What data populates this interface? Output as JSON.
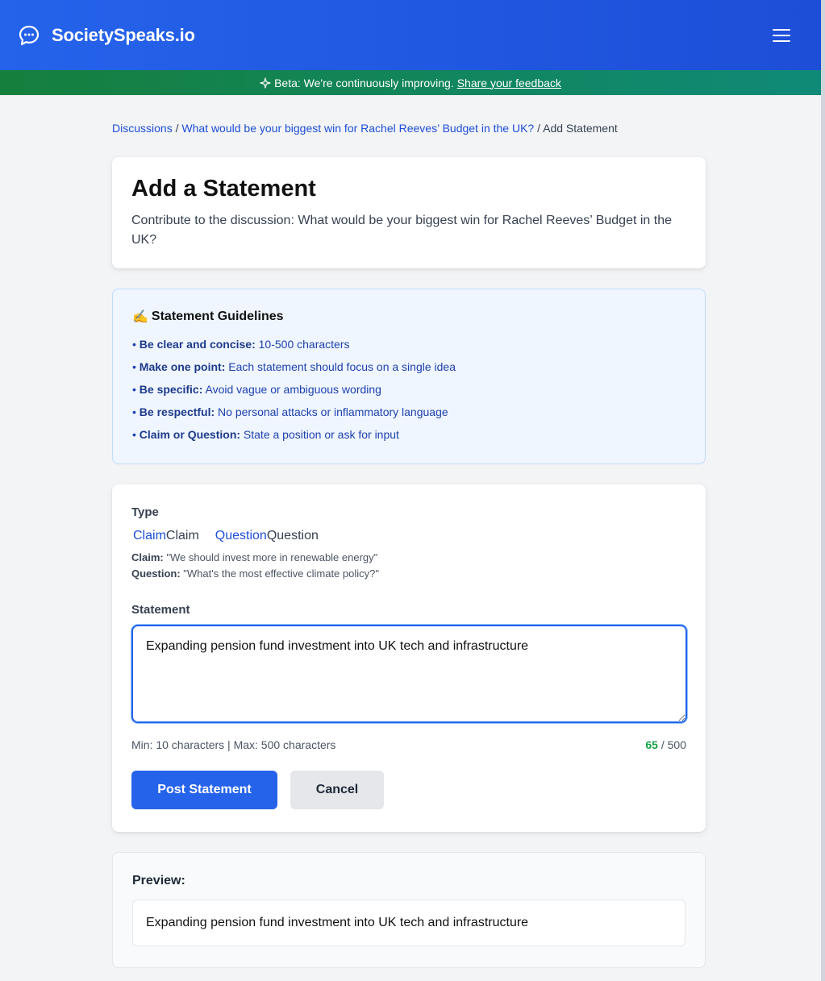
{
  "header": {
    "brand": "SocietySpeaks.io",
    "logo_icon": "chat-bubble-icon",
    "menu_icon": "hamburger-menu-icon",
    "colors": {
      "primary": "#2563eb",
      "beta_green": "#15803d",
      "beta_teal": "#0f8a78"
    }
  },
  "beta": {
    "icon": "sparkle-icon",
    "text": "Beta: We're continuously improving.",
    "link": "Share your feedback"
  },
  "breadcrumb": {
    "items": [
      {
        "label": "Discussions",
        "link": true
      },
      {
        "label": "What would be your biggest win for Rachel Reeves’ Budget in the UK?",
        "link": true
      },
      {
        "label": "Add Statement",
        "link": false
      }
    ],
    "separator": "/"
  },
  "title_card": {
    "title": "Add a Statement",
    "subtitle": "Contribute to the discussion: What would be your biggest win for Rachel Reeves’ Budget in the UK?"
  },
  "guidelines": {
    "emoji": "✍️",
    "title": "Statement Guidelines",
    "items": [
      {
        "bold": "Be clear and concise:",
        "text": "10-500 characters"
      },
      {
        "bold": "Make one point:",
        "text": "Each statement should focus on a single idea"
      },
      {
        "bold": "Be specific:",
        "text": "Avoid vague or ambiguous wording"
      },
      {
        "bold": "Be respectful:",
        "text": "No personal attacks or inflammatory language"
      },
      {
        "bold": "Claim or Question:",
        "text": "State a position or ask for input"
      }
    ]
  },
  "form": {
    "type_label": "Type",
    "types": [
      {
        "alt": "Claim",
        "label": "Claim"
      },
      {
        "alt": "Question",
        "label": "Question"
      }
    ],
    "examples": [
      {
        "bold": "Claim:",
        "text": "\"We should invest more in renewable energy\""
      },
      {
        "bold": "Question:",
        "text": "\"What's the most effective climate policy?\""
      }
    ],
    "statement_label": "Statement",
    "statement_value": "Expanding pension fund investment into UK tech and infrastructure",
    "limits_text": "Min: 10 characters | Max: 500 characters",
    "count_current": "65",
    "count_max": "/ 500",
    "post_button": "Post Statement",
    "cancel_button": "Cancel"
  },
  "preview": {
    "label": "Preview:",
    "text": "Expanding pension fund investment into UK tech and infrastructure"
  }
}
